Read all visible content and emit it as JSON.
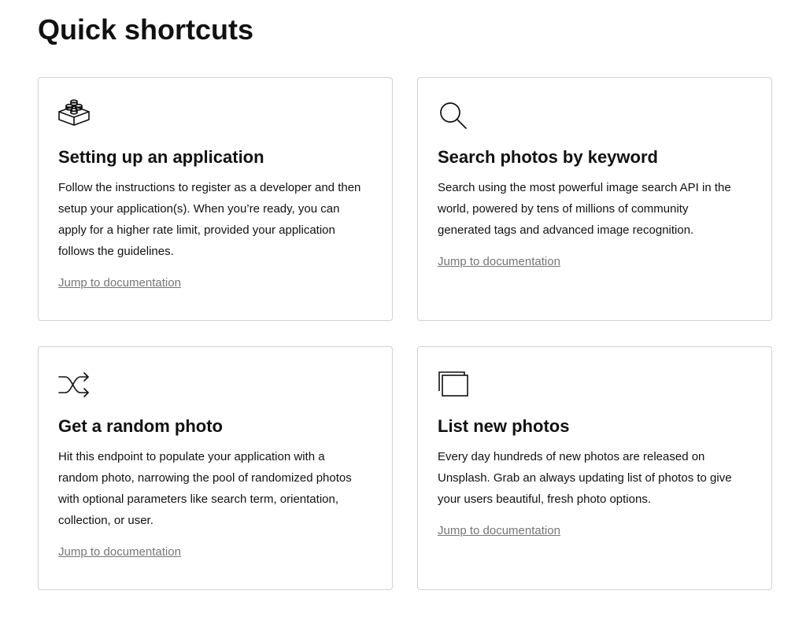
{
  "page": {
    "title": "Quick shortcuts"
  },
  "cards": [
    {
      "icon": "lego-brick-icon",
      "title": "Setting up an application",
      "text": "Follow the instructions to register as a developer and then setup your application(s). When you’re ready, you can apply for a higher rate limit, provided your application follows the guidelines.",
      "link": "Jump to documentation"
    },
    {
      "icon": "search-icon",
      "title": "Search photos by keyword",
      "text": "Search using the most powerful image search API in the world, powered by tens of millions of community generated tags and advanced image recognition.",
      "link": "Jump to documentation"
    },
    {
      "icon": "shuffle-icon",
      "title": "Get a random photo",
      "text": "Hit this endpoint to populate your application with a random photo, narrowing the pool of randomized photos with optional parameters like search term, orientation, collection, or user.",
      "link": "Jump to documentation"
    },
    {
      "icon": "stacked-windows-icon",
      "title": "List new photos",
      "text": "Every day hundreds of new photos are released on Unsplash. Grab an always updating list of photos to give your users beautiful, fresh photo options.",
      "link": "Jump to documentation"
    }
  ],
  "colors": {
    "text": "#111111",
    "link": "#767676",
    "border": "#d1d1d1"
  }
}
